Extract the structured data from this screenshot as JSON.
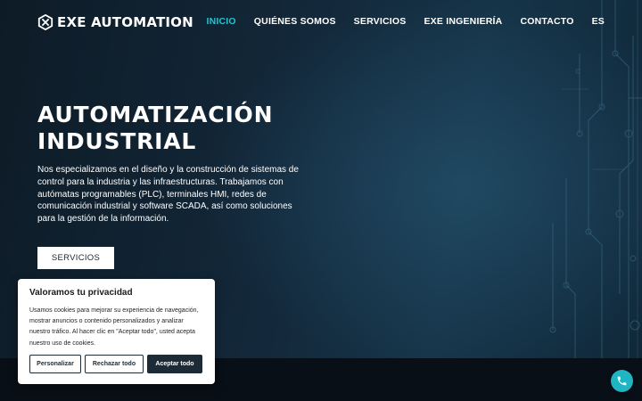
{
  "header": {
    "logo_text": "EXE AUTOMATION",
    "nav": [
      {
        "label": "INICIO",
        "active": true
      },
      {
        "label": "QUIÉNES SOMOS",
        "active": false
      },
      {
        "label": "SERVICIOS",
        "active": false
      },
      {
        "label": "EXE INGENIERÍA",
        "active": false
      },
      {
        "label": "CONTACTO",
        "active": false
      },
      {
        "label": "ES",
        "active": false
      }
    ]
  },
  "hero": {
    "title_line1": "AUTOMATIZACIÓN",
    "title_line2": "INDUSTRIAL",
    "description": "Nos especializamos en el diseño y la construcción de sistemas de control para la industria y las infraestructuras. Trabajamos con autómatas programables (PLC), terminales HMI, redes de comunicación industrial y software SCADA, así como soluciones para la gestión de la información.",
    "button_label": "SERVICIOS"
  },
  "cookie_banner": {
    "title": "Valoramos tu privacidad",
    "text": "Usamos cookies para mejorar su experiencia de navegación, mostrar anuncios o contenido personalizados y analizar nuestro tráfico. Al hacer clic en \"Aceptar todo\", usted acepta nuestro uso de cookies.",
    "customize_label": "Personalizar",
    "reject_label": "Rechazar todo",
    "accept_label": "Aceptar todo"
  },
  "fab": {
    "icon": "phone-icon"
  },
  "colors": {
    "accent": "#22c4cf",
    "background": "#0c1620",
    "button_dark": "#1d2b36"
  }
}
